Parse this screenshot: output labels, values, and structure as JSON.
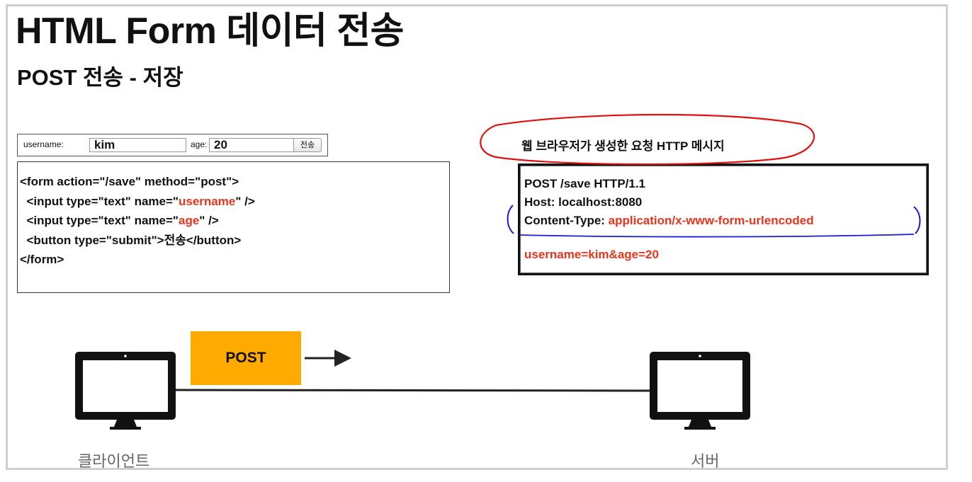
{
  "slide": {
    "title": "HTML Form 데이터 전송",
    "subtitle": "POST 전송 - 저장"
  },
  "form_preview": {
    "username_label": "username:",
    "username_value": "kim",
    "age_label": "age:",
    "age_value": "20",
    "submit_label": "전송"
  },
  "html_code": {
    "line1_a": "<form action=\"/save\" method=\"",
    "line1_b": "post",
    "line1_c": "\">",
    "line2_a": "  <input type=\"text\" name=\"",
    "line2_b": "username",
    "line2_c": "\" />",
    "line3_a": "  <input type=\"text\" name=\"",
    "line3_b": "age",
    "line3_c": "\" />",
    "line4": "  <button type=\"submit\">전송</button>",
    "line5": "</form>"
  },
  "http_message": {
    "caption": "웹 브라우저가 생성한 요청 HTTP 메시지",
    "request_line": "POST /save HTTP/1.1",
    "host_line": "Host: localhost:8080",
    "content_type_label": "Content-Type: ",
    "content_type_value": "application/x-www-form-urlencoded",
    "body": "username=kim&age=20"
  },
  "diagram": {
    "method_label": "POST",
    "client_label": "클라이언트",
    "server_label": "서버"
  },
  "colors": {
    "highlight_red": "#e8341c",
    "post_box": "#ffaa00",
    "annotation_red": "#e01010",
    "annotation_blue": "#1a1ad8"
  }
}
